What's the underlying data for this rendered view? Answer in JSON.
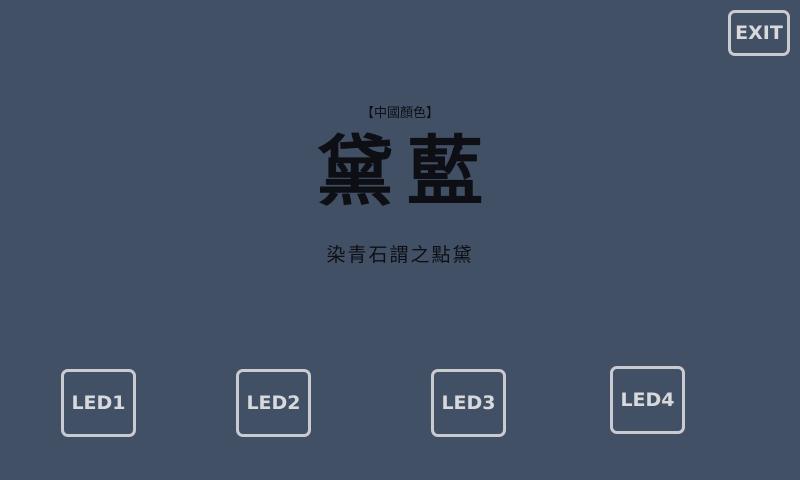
{
  "header": {
    "exit_label": "EXIT"
  },
  "color_card": {
    "category": "【中國顏色】",
    "name": "黛藍",
    "description": "染青石謂之點黛"
  },
  "controls": {
    "leds": [
      {
        "label": "LED1"
      },
      {
        "label": "LED2"
      },
      {
        "label": "LED3"
      },
      {
        "label": "LED4"
      }
    ]
  },
  "colors": {
    "background": "#425066",
    "button_border": "#c9cbd0",
    "button_text": "#d8d9dc",
    "title_text": "#0d0f14"
  }
}
